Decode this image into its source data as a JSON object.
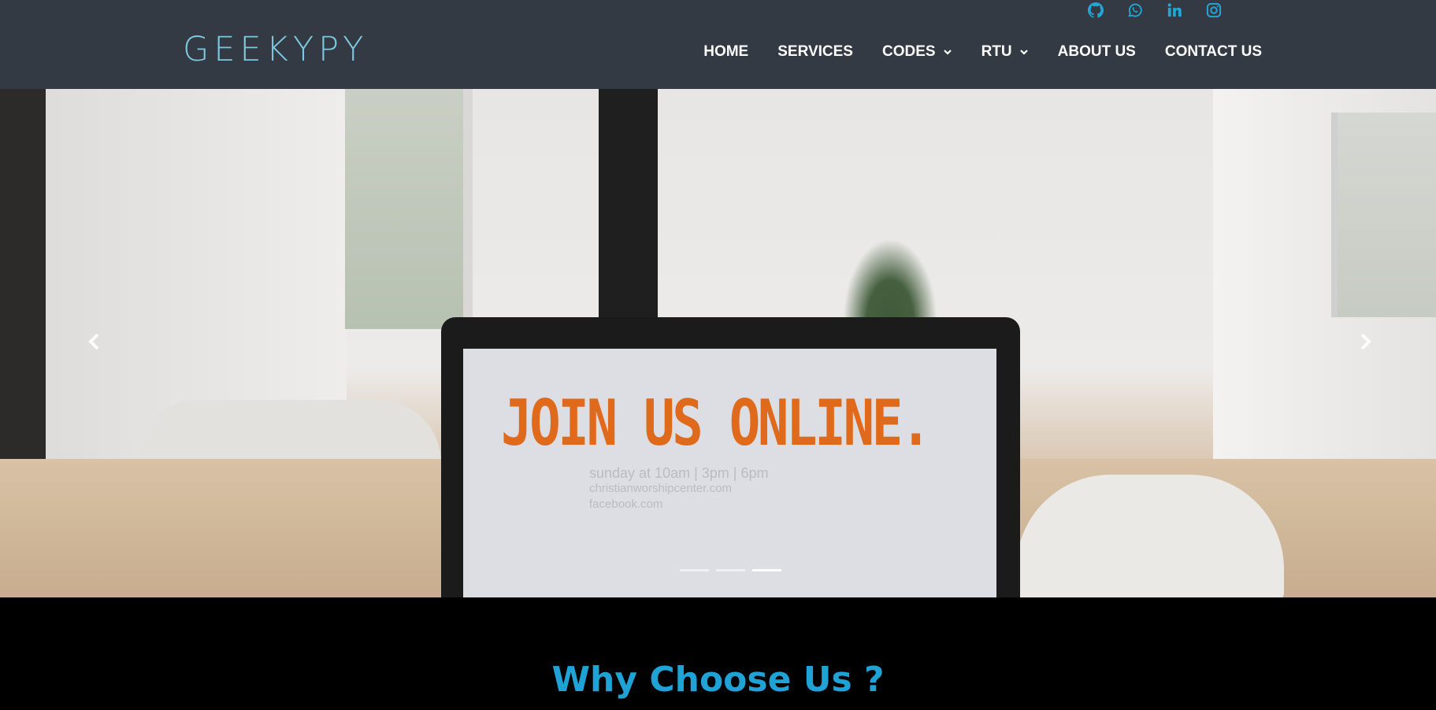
{
  "brand": {
    "logo": "GEEKYPY",
    "logo_color": "#7cc8e0"
  },
  "social": [
    {
      "name": "github",
      "icon": "github-icon"
    },
    {
      "name": "whatsapp",
      "icon": "whatsapp-icon"
    },
    {
      "name": "linkedin",
      "icon": "linkedin-icon"
    },
    {
      "name": "instagram",
      "icon": "instagram-icon"
    }
  ],
  "nav": {
    "items": [
      {
        "label": "HOME",
        "dropdown": false
      },
      {
        "label": "SERVICES",
        "dropdown": false
      },
      {
        "label": "CODES",
        "dropdown": true
      },
      {
        "label": "RTU",
        "dropdown": true
      },
      {
        "label": "ABOUT US",
        "dropdown": false
      },
      {
        "label": "CONTACT US",
        "dropdown": false
      }
    ]
  },
  "hero": {
    "slide_text": "JOIN US ONLINE.",
    "slide_subtext": [
      "sunday at 10am | 3pm | 6pm",
      "christianworshipcenter.com",
      "facebook.com"
    ],
    "slide_count": 3,
    "active_slide": 3
  },
  "section": {
    "heading": "Why Choose Us ?"
  },
  "colors": {
    "header_bg": "#333a44",
    "accent": "#1fa3d6",
    "page_bg": "#000000"
  }
}
